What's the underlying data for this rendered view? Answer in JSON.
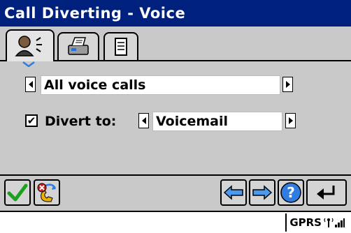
{
  "title": "Call Diverting - Voice",
  "tabs": [
    {
      "icon": "person-speaking-icon",
      "active": true
    },
    {
      "icon": "fax-icon",
      "active": false
    },
    {
      "icon": "document-icon",
      "active": false
    }
  ],
  "divert_condition": {
    "selected": "All voice calls"
  },
  "divert_to": {
    "checked": true,
    "label": "Divert to:",
    "selected": "Voicemail"
  },
  "toolbar": {
    "buttons": [
      "checkmark-icon",
      "cancel-divert-icon",
      "back-arrow-icon",
      "forward-arrow-icon",
      "help-icon",
      "return-icon"
    ]
  },
  "status": {
    "network": "GPRS"
  },
  "colors": {
    "titlebar": "#00207e",
    "background": "#c9c9c9",
    "accent_blue": "#2f7de1",
    "check_green": "#1aa31a"
  }
}
